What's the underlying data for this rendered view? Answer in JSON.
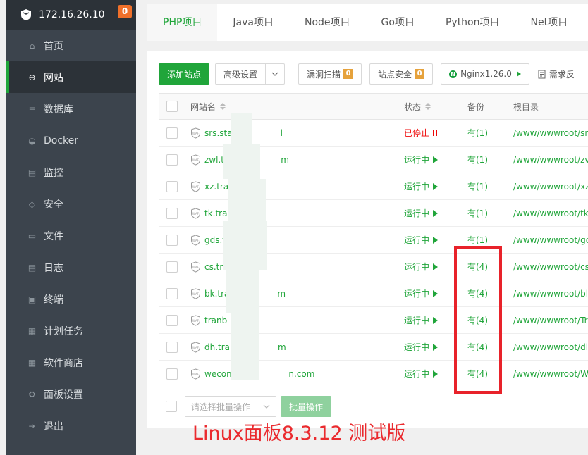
{
  "sidebar": {
    "server_ip": "172.16.26.10",
    "badge_count": "0",
    "items": [
      {
        "label": "首页",
        "icon": "home-icon"
      },
      {
        "label": "网站",
        "icon": "globe-icon",
        "active": true
      },
      {
        "label": "数据库",
        "icon": "database-icon"
      },
      {
        "label": "Docker",
        "icon": "docker-icon"
      },
      {
        "label": "监控",
        "icon": "monitor-icon"
      },
      {
        "label": "安全",
        "icon": "shield-icon"
      },
      {
        "label": "文件",
        "icon": "folder-icon"
      },
      {
        "label": "日志",
        "icon": "log-icon"
      },
      {
        "label": "终端",
        "icon": "terminal-icon"
      },
      {
        "label": "计划任务",
        "icon": "calendar-icon"
      },
      {
        "label": "软件商店",
        "icon": "grid-icon"
      },
      {
        "label": "面板设置",
        "icon": "gear-icon"
      },
      {
        "label": "退出",
        "icon": "logout-icon"
      }
    ]
  },
  "tabs": [
    "PHP项目",
    "Java项目",
    "Node项目",
    "Go项目",
    "Python项目",
    "Net项目"
  ],
  "toolbar": {
    "add_site": "添加站点",
    "advanced": "高级设置",
    "vuln_scan": "漏洞扫描",
    "vuln_count": "0",
    "site_security": "站点安全",
    "security_count": "0",
    "nginx": "Nginx1.26.0",
    "requirement": "需求反"
  },
  "table": {
    "headers": {
      "name": "网站名",
      "status": "状态",
      "backup": "备份",
      "root": "根目录"
    },
    "rows": [
      {
        "name": "srs.sta",
        "name_tail": "l",
        "status": "已停止",
        "running": false,
        "backup": "有(1)",
        "root": "/www/wwwroot/sr"
      },
      {
        "name": "zwl.tra",
        "name_tail": "m",
        "status": "运行中",
        "running": true,
        "backup": "有(1)",
        "root": "/www/wwwroot/zv"
      },
      {
        "name": "xz.tra",
        "name_tail": "",
        "status": "运行中",
        "running": true,
        "backup": "有(1)",
        "root": "/www/wwwroot/xz"
      },
      {
        "name": "tk.tra",
        "name_tail": "",
        "status": "运行中",
        "running": true,
        "backup": "有(1)",
        "root": "/www/wwwroot/tk"
      },
      {
        "name": "gds.tr",
        "name_tail": "",
        "status": "运行中",
        "running": true,
        "backup": "有(1)",
        "root": "/www/wwwroot/gc"
      },
      {
        "name": "cs.tra",
        "name_tail": "",
        "status": "运行中",
        "running": true,
        "backup": "有(4)",
        "root": "/www/wwwroot/cs"
      },
      {
        "name": "bk.tra",
        "name_tail": "m",
        "status": "运行中",
        "running": true,
        "backup": "有(4)",
        "root": "/www/wwwroot/bl"
      },
      {
        "name": "tranb",
        "name_tail": "",
        "status": "运行中",
        "running": true,
        "backup": "有(4)",
        "root": "/www/wwwroot/Tr"
      },
      {
        "name": "dh.tra",
        "name_tail": "m",
        "status": "运行中",
        "running": true,
        "backup": "有(4)",
        "root": "/www/wwwroot/dl"
      },
      {
        "name": "wecom.t",
        "name_tail": "n.com",
        "status": "运行中",
        "running": true,
        "backup": "有(4)",
        "root": "/www/wwwroot/W"
      }
    ]
  },
  "bottom": {
    "select_placeholder": "请选择批量操作",
    "batch_button": "批量操作"
  },
  "caption": "Linux面板8.3.12 测试版",
  "colors": {
    "accent": "#20a53a",
    "sidebar": "#3c444d",
    "stopped": "#ef0808",
    "highlight": "#e8222a"
  }
}
